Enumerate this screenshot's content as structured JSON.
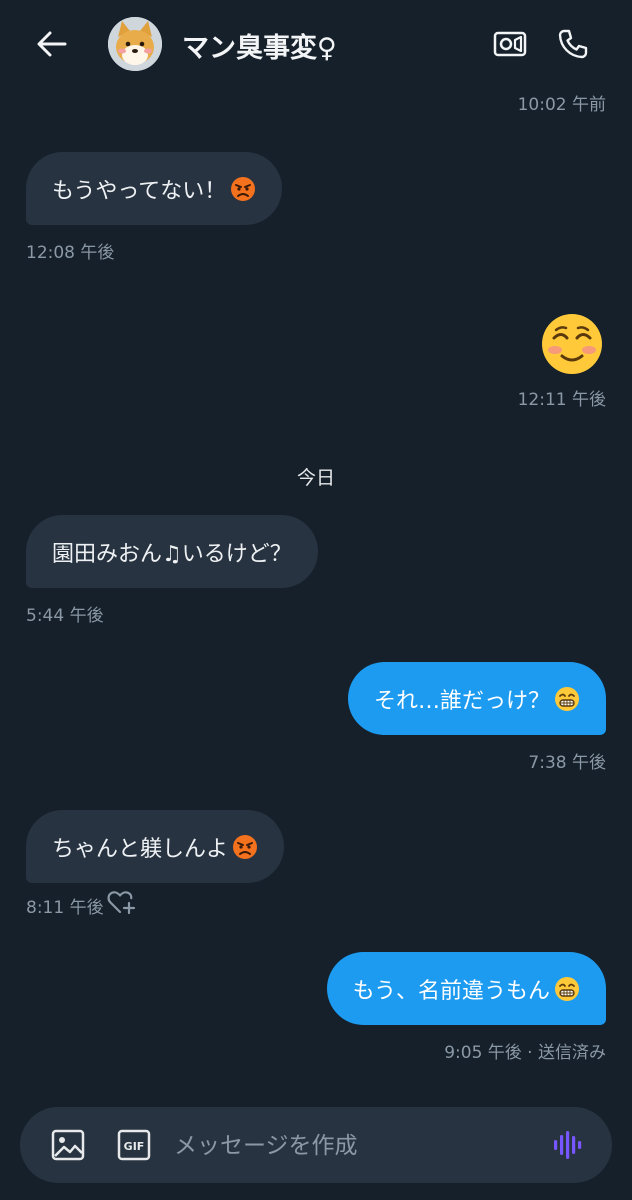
{
  "header": {
    "title": "マン臭事変♀",
    "back_icon": "arrow-left-icon",
    "video_icon": "video-call-icon",
    "call_icon": "phone-icon"
  },
  "messages": [
    {
      "direction": "out",
      "time": "10:02 午前"
    },
    {
      "direction": "in",
      "text": "もうやってない！",
      "emoji": "angry-face",
      "time": "12:08 午後"
    },
    {
      "direction": "out",
      "emoji": "smiling-face",
      "time": "12:11 午後"
    },
    {
      "direction": "in",
      "text": "園田みおん♫いるけど？",
      "time": "5:44 午後"
    },
    {
      "direction": "out",
      "text": "それ…誰だっけ？",
      "emoji": "grinning-face",
      "time": "7:38 午後"
    },
    {
      "direction": "in",
      "text": "ちゃんと躾しんよ",
      "emoji": "angry-face",
      "time": "8:11 午後"
    },
    {
      "direction": "out",
      "text": "もう、名前違うもん",
      "emoji": "grinning-face",
      "time": "9:05 午後 · 送信済み"
    }
  ],
  "day_divider": "今日",
  "composer": {
    "placeholder": "メッセージを作成",
    "gif_label": "GIF",
    "image_icon": "image-icon",
    "voice_icon": "voice-waveform-icon"
  },
  "colors": {
    "background": "#15202b",
    "incoming_bubble": "#273340",
    "outgoing_bubble": "#1d9bf0",
    "muted_text": "#8b98a5",
    "voice_accent": "#7856ff"
  }
}
